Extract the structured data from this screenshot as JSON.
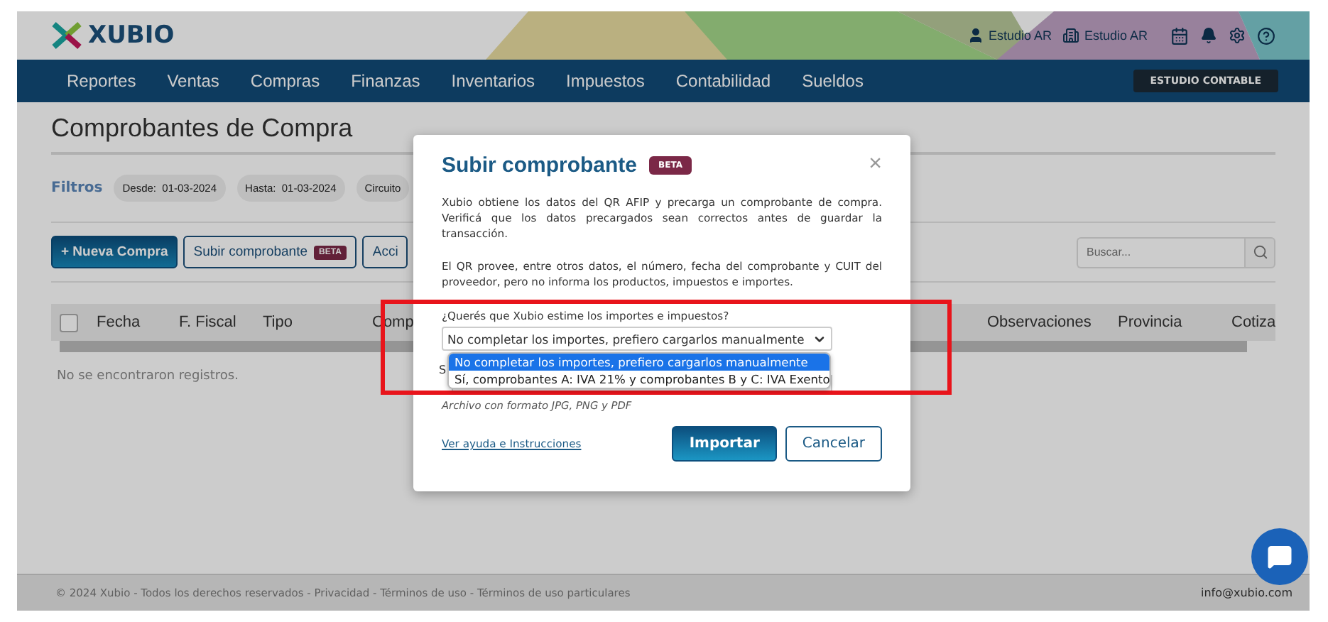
{
  "header": {
    "logo": "XUBIO",
    "user": "Estudio AR",
    "company": "Estudio AR"
  },
  "nav": {
    "items": [
      "Reportes",
      "Ventas",
      "Compras",
      "Finanzas",
      "Inventarios",
      "Impuestos",
      "Contabilidad",
      "Sueldos"
    ],
    "badge": "ESTUDIO CONTABLE"
  },
  "page": {
    "title": "Comprobantes de Compra",
    "filters_label": "Filtros",
    "filters": [
      "Desde:  01-03-2024",
      "Hasta:  01-03-2024",
      "Circuito"
    ]
  },
  "actions": [
    {
      "label": "+ Nueva Compra",
      "kind": "primary"
    },
    {
      "label": "Subir comprobante",
      "kind": "outline",
      "badge": "BETA"
    },
    {
      "label": "Acci",
      "kind": "outline"
    }
  ],
  "search": {
    "placeholder": "Buscar..."
  },
  "table": {
    "select_all": {
      "checked": false
    },
    "columns": [
      "Fecha",
      "F. Fiscal",
      "Tipo",
      "Comp",
      "Observaciones",
      "Provincia",
      "Cotiza"
    ],
    "empty": "No se encontraron registros."
  },
  "footer": {
    "text": "© 2024 Xubio - Todos los derechos reservados - Privacidad - Términos de uso - Términos de uso particulares",
    "email": "info@xubio.com"
  },
  "modal": {
    "title": "Subir comprobante",
    "badge": "BETA",
    "close": "×",
    "paragraphs": [
      "Xubio obtiene los datos del QR AFIP y precarga un comprobante de compra. Verificá que los datos precargados sean correctos antes de guardar la transacción.",
      "El QR provee, entre otros datos, el número, fecha del comprobante y CUIT del proveedor, pero no informa los productos, impuestos e importes."
    ],
    "question": "¿Querés que Xubio estime los importes e impuestos?",
    "select": {
      "value": "No completar los importes, prefiero cargarlos manualmente",
      "options": [
        {
          "label": "No completar los importes, prefiero cargarlos manualmente",
          "selected": true
        },
        {
          "label": "Sí, comprobantes A: IVA 21% y comprobantes B y C: IVA Exento",
          "selected": false
        }
      ]
    },
    "file_label": "S",
    "hint": "Archivo con formato JPG, PNG y PDF",
    "help_link": "Ver ayuda e Instrucciones",
    "buttons": [
      {
        "label": "Importar",
        "kind": "primary"
      },
      {
        "label": "Cancelar",
        "kind": "secondary"
      }
    ]
  }
}
